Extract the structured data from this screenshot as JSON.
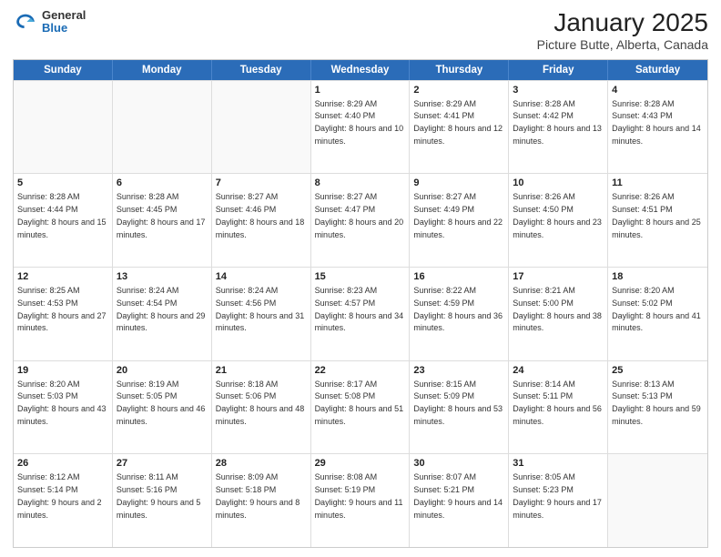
{
  "logo": {
    "general": "General",
    "blue": "Blue"
  },
  "header": {
    "title": "January 2025",
    "subtitle": "Picture Butte, Alberta, Canada"
  },
  "calendar": {
    "days_of_week": [
      "Sunday",
      "Monday",
      "Tuesday",
      "Wednesday",
      "Thursday",
      "Friday",
      "Saturday"
    ],
    "weeks": [
      [
        {
          "day": "",
          "empty": true
        },
        {
          "day": "",
          "empty": true
        },
        {
          "day": "",
          "empty": true
        },
        {
          "day": "1",
          "sunrise": "8:29 AM",
          "sunset": "4:40 PM",
          "daylight": "8 hours and 10 minutes."
        },
        {
          "day": "2",
          "sunrise": "8:29 AM",
          "sunset": "4:41 PM",
          "daylight": "8 hours and 12 minutes."
        },
        {
          "day": "3",
          "sunrise": "8:28 AM",
          "sunset": "4:42 PM",
          "daylight": "8 hours and 13 minutes."
        },
        {
          "day": "4",
          "sunrise": "8:28 AM",
          "sunset": "4:43 PM",
          "daylight": "8 hours and 14 minutes."
        }
      ],
      [
        {
          "day": "5",
          "sunrise": "8:28 AM",
          "sunset": "4:44 PM",
          "daylight": "8 hours and 15 minutes."
        },
        {
          "day": "6",
          "sunrise": "8:28 AM",
          "sunset": "4:45 PM",
          "daylight": "8 hours and 17 minutes."
        },
        {
          "day": "7",
          "sunrise": "8:27 AM",
          "sunset": "4:46 PM",
          "daylight": "8 hours and 18 minutes."
        },
        {
          "day": "8",
          "sunrise": "8:27 AM",
          "sunset": "4:47 PM",
          "daylight": "8 hours and 20 minutes."
        },
        {
          "day": "9",
          "sunrise": "8:27 AM",
          "sunset": "4:49 PM",
          "daylight": "8 hours and 22 minutes."
        },
        {
          "day": "10",
          "sunrise": "8:26 AM",
          "sunset": "4:50 PM",
          "daylight": "8 hours and 23 minutes."
        },
        {
          "day": "11",
          "sunrise": "8:26 AM",
          "sunset": "4:51 PM",
          "daylight": "8 hours and 25 minutes."
        }
      ],
      [
        {
          "day": "12",
          "sunrise": "8:25 AM",
          "sunset": "4:53 PM",
          "daylight": "8 hours and 27 minutes."
        },
        {
          "day": "13",
          "sunrise": "8:24 AM",
          "sunset": "4:54 PM",
          "daylight": "8 hours and 29 minutes."
        },
        {
          "day": "14",
          "sunrise": "8:24 AM",
          "sunset": "4:56 PM",
          "daylight": "8 hours and 31 minutes."
        },
        {
          "day": "15",
          "sunrise": "8:23 AM",
          "sunset": "4:57 PM",
          "daylight": "8 hours and 34 minutes."
        },
        {
          "day": "16",
          "sunrise": "8:22 AM",
          "sunset": "4:59 PM",
          "daylight": "8 hours and 36 minutes."
        },
        {
          "day": "17",
          "sunrise": "8:21 AM",
          "sunset": "5:00 PM",
          "daylight": "8 hours and 38 minutes."
        },
        {
          "day": "18",
          "sunrise": "8:20 AM",
          "sunset": "5:02 PM",
          "daylight": "8 hours and 41 minutes."
        }
      ],
      [
        {
          "day": "19",
          "sunrise": "8:20 AM",
          "sunset": "5:03 PM",
          "daylight": "8 hours and 43 minutes."
        },
        {
          "day": "20",
          "sunrise": "8:19 AM",
          "sunset": "5:05 PM",
          "daylight": "8 hours and 46 minutes."
        },
        {
          "day": "21",
          "sunrise": "8:18 AM",
          "sunset": "5:06 PM",
          "daylight": "8 hours and 48 minutes."
        },
        {
          "day": "22",
          "sunrise": "8:17 AM",
          "sunset": "5:08 PM",
          "daylight": "8 hours and 51 minutes."
        },
        {
          "day": "23",
          "sunrise": "8:15 AM",
          "sunset": "5:09 PM",
          "daylight": "8 hours and 53 minutes."
        },
        {
          "day": "24",
          "sunrise": "8:14 AM",
          "sunset": "5:11 PM",
          "daylight": "8 hours and 56 minutes."
        },
        {
          "day": "25",
          "sunrise": "8:13 AM",
          "sunset": "5:13 PM",
          "daylight": "8 hours and 59 minutes."
        }
      ],
      [
        {
          "day": "26",
          "sunrise": "8:12 AM",
          "sunset": "5:14 PM",
          "daylight": "9 hours and 2 minutes."
        },
        {
          "day": "27",
          "sunrise": "8:11 AM",
          "sunset": "5:16 PM",
          "daylight": "9 hours and 5 minutes."
        },
        {
          "day": "28",
          "sunrise": "8:09 AM",
          "sunset": "5:18 PM",
          "daylight": "9 hours and 8 minutes."
        },
        {
          "day": "29",
          "sunrise": "8:08 AM",
          "sunset": "5:19 PM",
          "daylight": "9 hours and 11 minutes."
        },
        {
          "day": "30",
          "sunrise": "8:07 AM",
          "sunset": "5:21 PM",
          "daylight": "9 hours and 14 minutes."
        },
        {
          "day": "31",
          "sunrise": "8:05 AM",
          "sunset": "5:23 PM",
          "daylight": "9 hours and 17 minutes."
        },
        {
          "day": "",
          "empty": true
        }
      ]
    ]
  }
}
